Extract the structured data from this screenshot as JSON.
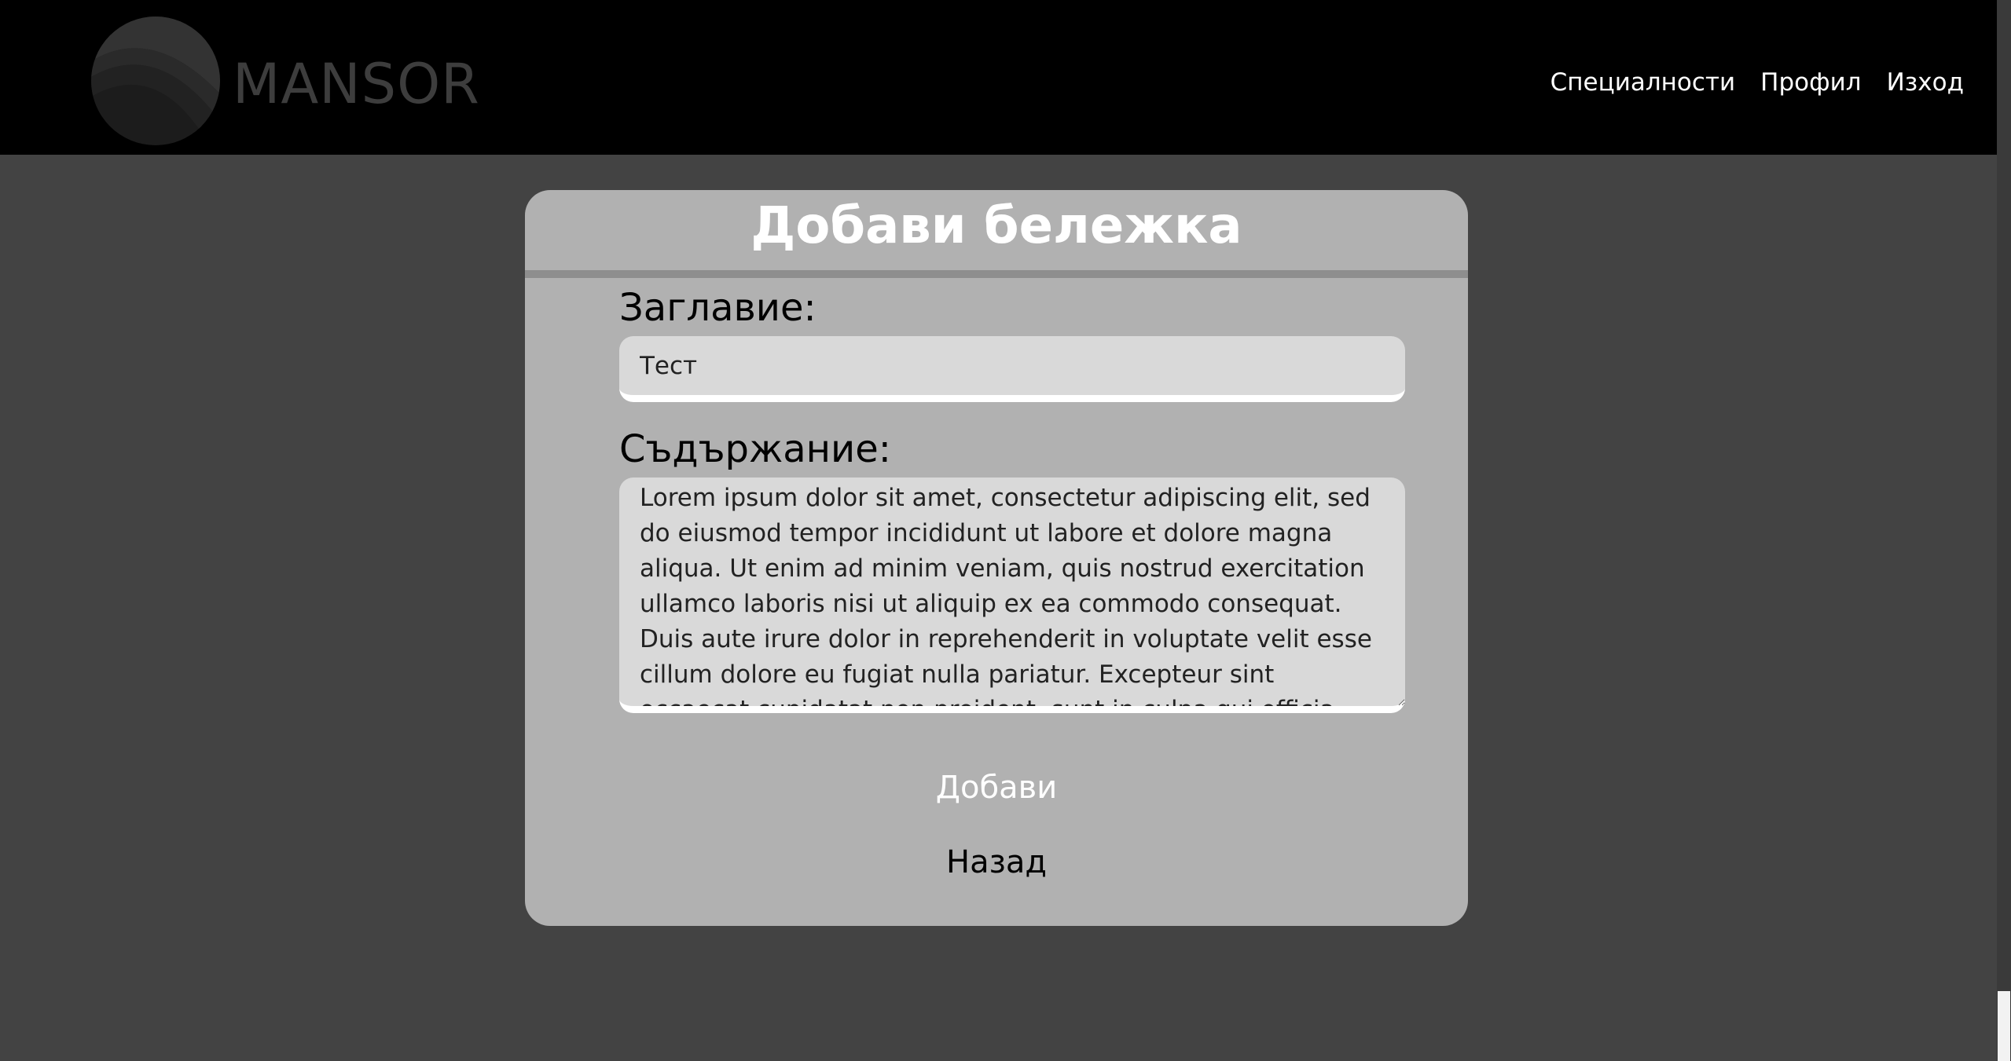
{
  "header": {
    "brand": "MANSOR",
    "nav": [
      {
        "label": "Специалности"
      },
      {
        "label": "Профил"
      },
      {
        "label": "Изход"
      }
    ]
  },
  "form": {
    "title": "Добави бележка",
    "title_label": "Заглавие:",
    "title_value": "Тест",
    "content_label": "Съдържание:",
    "content_value": "Lorem ipsum dolor sit amet, consectetur adipiscing elit, sed do eiusmod tempor incididunt ut labore et dolore magna aliqua. Ut enim ad minim veniam, quis nostrud exercitation ullamco laboris nisi ut aliquip ex ea commodo consequat. Duis aute irure dolor in reprehenderit in voluptate velit esse cillum dolore eu fugiat nulla pariatur. Excepteur sint occaecat cupidatat non proident, sunt in culpa qui officia deserunt mollit anim id est laborum.",
    "submit_label": "Добави",
    "back_label": "Назад"
  },
  "colors": {
    "header_bg": "#000000",
    "page_bg": "#434343",
    "card_bg": "#b1b1b1",
    "field_bg": "#d9d9d9"
  }
}
